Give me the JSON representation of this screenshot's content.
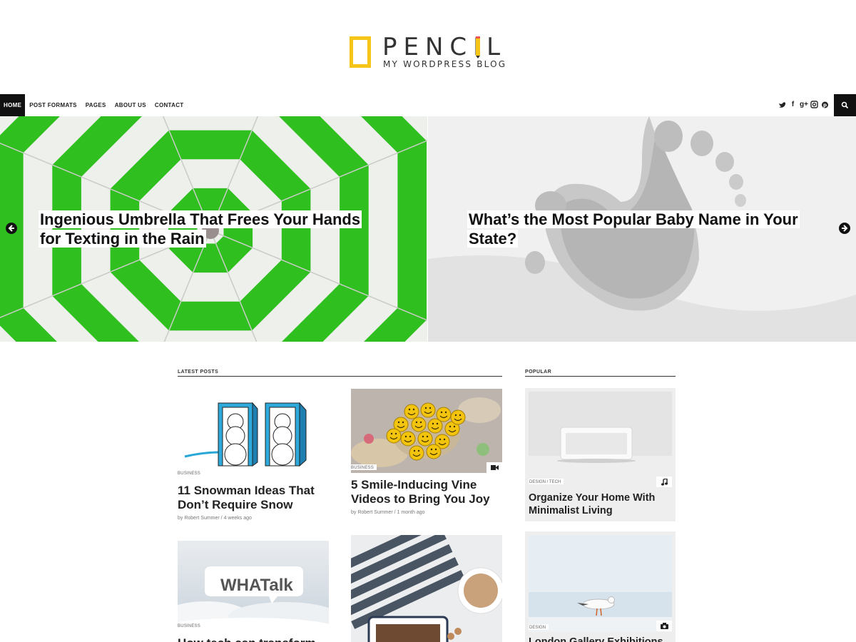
{
  "site": {
    "title": "PENCIL",
    "tagline": "MY WORDPRESS BLOG",
    "brand_color": "#f5c518"
  },
  "nav": {
    "items": [
      {
        "label": "HOME",
        "active": true
      },
      {
        "label": "POST FORMATS"
      },
      {
        "label": "PAGES"
      },
      {
        "label": "ABOUT US"
      },
      {
        "label": "CONTACT"
      }
    ],
    "social_icons": [
      "twitter-icon",
      "facebook-icon",
      "google-plus-icon",
      "instagram-icon",
      "pinterest-icon"
    ],
    "social_glyphs": [
      "🐦",
      "f",
      "g+",
      "◎",
      "℗"
    ],
    "search_icon": "search-icon"
  },
  "slider": {
    "slides": [
      {
        "title": "Ingenious Umbrella That Frees Your Hands for Texting in the Rain"
      },
      {
        "title": "What’s the Most Popular Baby Name in Your State?"
      }
    ],
    "prev_icon": "arrow-left-icon",
    "next_icon": "arrow-right-icon"
  },
  "latest": {
    "heading": "LATEST POSTS",
    "posts": [
      {
        "category": "BUSINESS",
        "title": "11 Snowman Ideas That Don’t Require Snow",
        "meta": "by Robert Summer / 4 weeks ago"
      },
      {
        "category": "BUSINESS",
        "title": "5 Smile-Inducing Vine Videos to Bring You Joy",
        "meta": "by Robert Summer / 1 month ago",
        "format_icon": "video-camera-icon"
      },
      {
        "category": "BUSINESS",
        "title": "How tech can transform",
        "image_text": "WHATalk"
      },
      {
        "category": "",
        "title": ""
      }
    ]
  },
  "popular": {
    "heading": "POPULAR",
    "posts": [
      {
        "category": "DESIGN / TECH",
        "title": "Organize Your Home With Minimalist Living",
        "format_icon": "music-note-icon"
      },
      {
        "category": "DESIGN",
        "title": "London Gallery Exhibitions",
        "format_icon": "camera-icon"
      }
    ]
  },
  "colors": {
    "green": "#2fbf1f",
    "dark": "#111111",
    "accent_blue": "#29a8d8"
  }
}
